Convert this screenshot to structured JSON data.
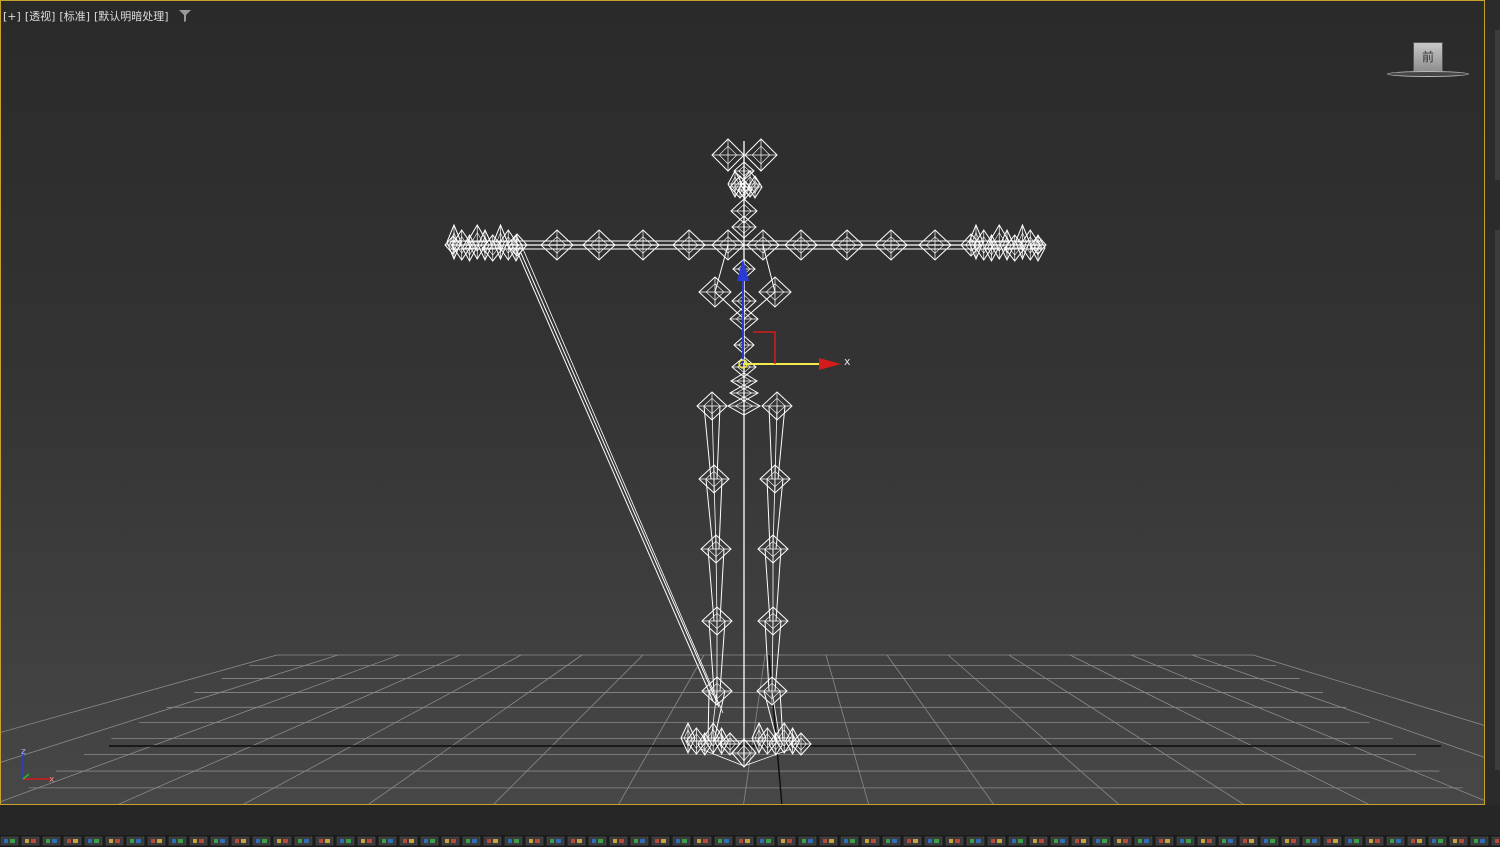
{
  "viewport": {
    "labels": [
      "[+]",
      "[透视]",
      "[标准]",
      "[默认明暗处理]"
    ],
    "filter_icon": "filter-funnel-icon",
    "border_color": "#c8a32a",
    "background_top": "#2a2a2a",
    "background_bottom": "#474747"
  },
  "viewcube": {
    "face_label": "前",
    "icon": "viewcube-icon"
  },
  "gizmo": {
    "x_label": "x",
    "x_color": "#d41c1c",
    "y_color": "#1fbf1f",
    "z_color": "#2a3bd6",
    "selected_axis_color": "#f3e94a"
  },
  "axis_tripod": {
    "x_label": "x",
    "z_label": "z"
  },
  "colors": {
    "wire": "#ffffff",
    "grid": "#8a8a8a",
    "grid_axis": "#0d0d0d"
  }
}
